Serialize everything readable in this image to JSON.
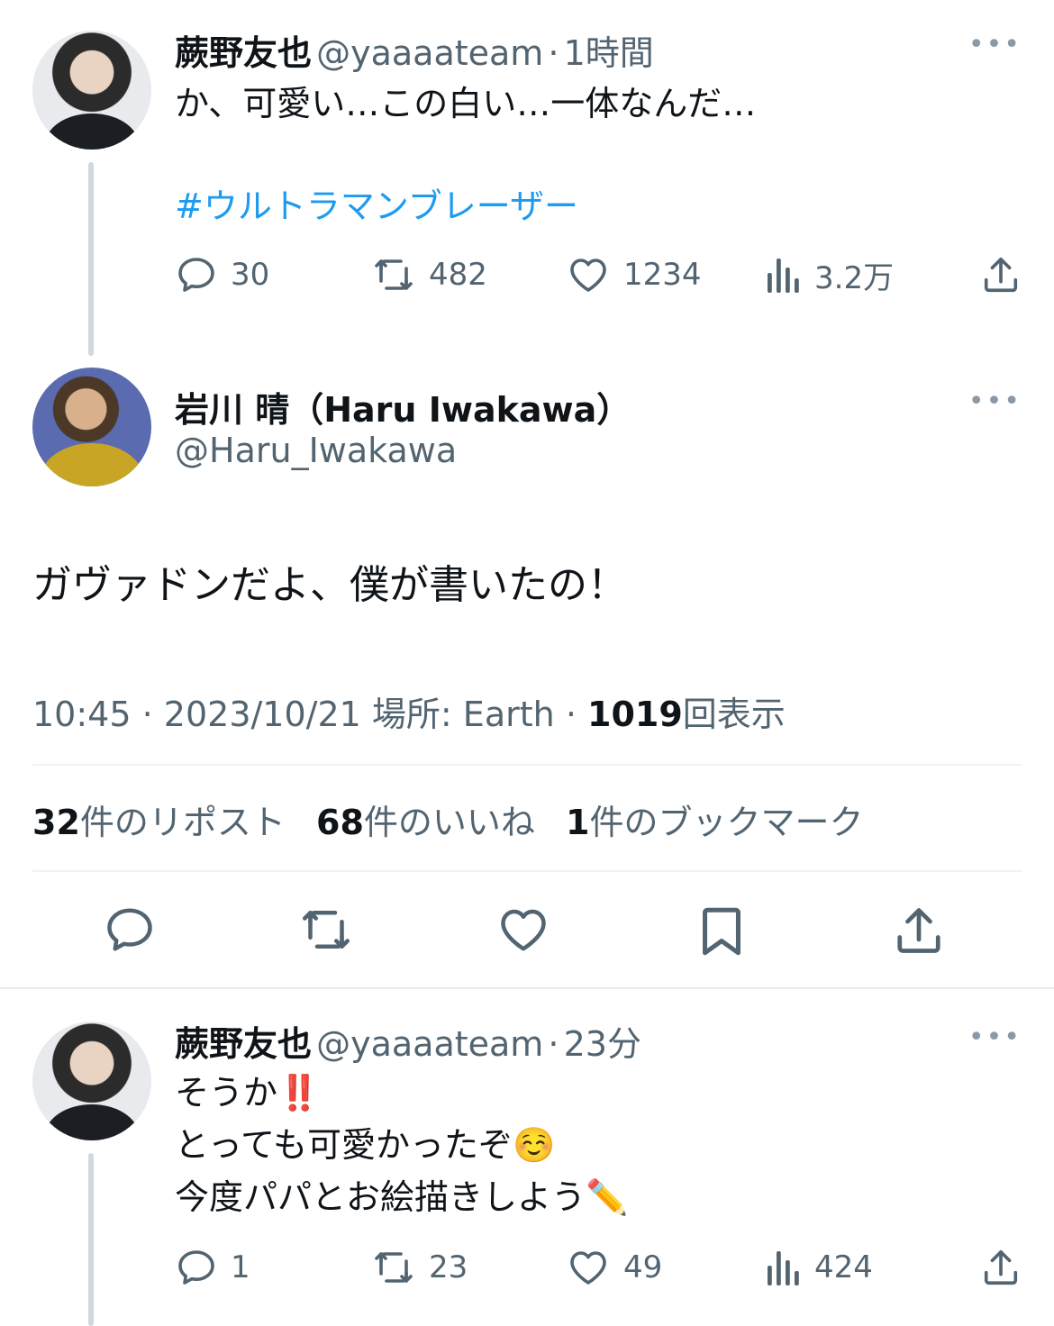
{
  "tweet1": {
    "name": "蕨野友也",
    "handle": "@yaaaateam",
    "dot": "·",
    "time": "1時間",
    "text": "か、可愛い…この白い…一体なんだ…",
    "hashtag": "#ウルトラマンブレーザー",
    "replies": "30",
    "reposts": "482",
    "likes": "1234",
    "views": "3.2万"
  },
  "main_tweet": {
    "name": "岩川 晴（Haru Iwakawa）",
    "handle": "@Haru_Iwakawa",
    "text": "ガヴァドンだよ、僕が書いたの！",
    "time": "10:45",
    "dot1": "·",
    "date": "2023/10/21",
    "location": "場所: Earth",
    "dot2": "·",
    "views_count": "1019",
    "views_label": "回表示",
    "reposts_count": "32",
    "reposts_label": "件のリポスト",
    "likes_count": "68",
    "likes_label": "件のいいね",
    "bookmarks_count": "1",
    "bookmarks_label": "件のブックマーク"
  },
  "tweet3": {
    "name": "蕨野友也",
    "handle": "@yaaaateam",
    "dot": "·",
    "time": "23分",
    "line1": "そうか",
    "emoji1": "‼️",
    "line2": "とっても可愛かったぞ",
    "emoji2": "☺️",
    "line3": "今度パパとお絵描きしよう",
    "emoji3": "✏️",
    "replies": "1",
    "reposts": "23",
    "likes": "49",
    "views": "424"
  },
  "icons": [
    "more-icon",
    "reply-icon",
    "repost-icon",
    "like-icon",
    "views-icon",
    "share-icon",
    "bookmark-icon"
  ],
  "colors": {
    "link": "#1d9bf0",
    "secondary": "#536471",
    "thread": "#cfd9de"
  }
}
